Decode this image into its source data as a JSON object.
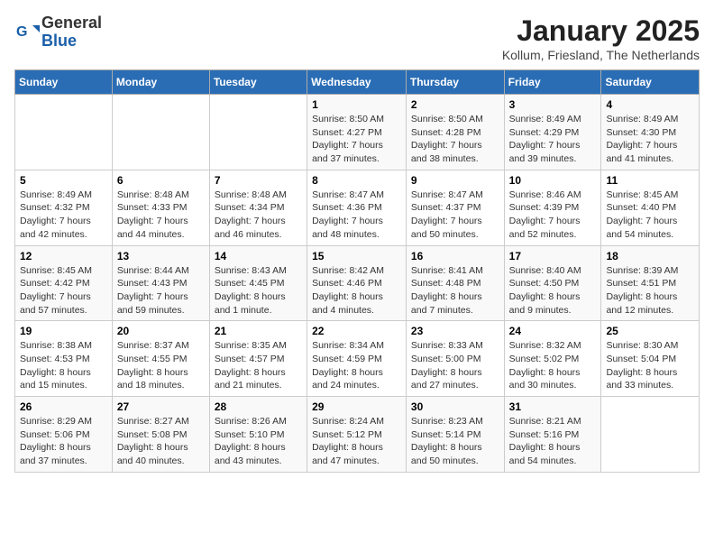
{
  "logo": {
    "general": "General",
    "blue": "Blue"
  },
  "title": "January 2025",
  "subtitle": "Kollum, Friesland, The Netherlands",
  "weekdays": [
    "Sunday",
    "Monday",
    "Tuesday",
    "Wednesday",
    "Thursday",
    "Friday",
    "Saturday"
  ],
  "weeks": [
    [
      {
        "day": "",
        "info": ""
      },
      {
        "day": "",
        "info": ""
      },
      {
        "day": "",
        "info": ""
      },
      {
        "day": "1",
        "info": "Sunrise: 8:50 AM\nSunset: 4:27 PM\nDaylight: 7 hours and 37 minutes."
      },
      {
        "day": "2",
        "info": "Sunrise: 8:50 AM\nSunset: 4:28 PM\nDaylight: 7 hours and 38 minutes."
      },
      {
        "day": "3",
        "info": "Sunrise: 8:49 AM\nSunset: 4:29 PM\nDaylight: 7 hours and 39 minutes."
      },
      {
        "day": "4",
        "info": "Sunrise: 8:49 AM\nSunset: 4:30 PM\nDaylight: 7 hours and 41 minutes."
      }
    ],
    [
      {
        "day": "5",
        "info": "Sunrise: 8:49 AM\nSunset: 4:32 PM\nDaylight: 7 hours and 42 minutes."
      },
      {
        "day": "6",
        "info": "Sunrise: 8:48 AM\nSunset: 4:33 PM\nDaylight: 7 hours and 44 minutes."
      },
      {
        "day": "7",
        "info": "Sunrise: 8:48 AM\nSunset: 4:34 PM\nDaylight: 7 hours and 46 minutes."
      },
      {
        "day": "8",
        "info": "Sunrise: 8:47 AM\nSunset: 4:36 PM\nDaylight: 7 hours and 48 minutes."
      },
      {
        "day": "9",
        "info": "Sunrise: 8:47 AM\nSunset: 4:37 PM\nDaylight: 7 hours and 50 minutes."
      },
      {
        "day": "10",
        "info": "Sunrise: 8:46 AM\nSunset: 4:39 PM\nDaylight: 7 hours and 52 minutes."
      },
      {
        "day": "11",
        "info": "Sunrise: 8:45 AM\nSunset: 4:40 PM\nDaylight: 7 hours and 54 minutes."
      }
    ],
    [
      {
        "day": "12",
        "info": "Sunrise: 8:45 AM\nSunset: 4:42 PM\nDaylight: 7 hours and 57 minutes."
      },
      {
        "day": "13",
        "info": "Sunrise: 8:44 AM\nSunset: 4:43 PM\nDaylight: 7 hours and 59 minutes."
      },
      {
        "day": "14",
        "info": "Sunrise: 8:43 AM\nSunset: 4:45 PM\nDaylight: 8 hours and 1 minute."
      },
      {
        "day": "15",
        "info": "Sunrise: 8:42 AM\nSunset: 4:46 PM\nDaylight: 8 hours and 4 minutes."
      },
      {
        "day": "16",
        "info": "Sunrise: 8:41 AM\nSunset: 4:48 PM\nDaylight: 8 hours and 7 minutes."
      },
      {
        "day": "17",
        "info": "Sunrise: 8:40 AM\nSunset: 4:50 PM\nDaylight: 8 hours and 9 minutes."
      },
      {
        "day": "18",
        "info": "Sunrise: 8:39 AM\nSunset: 4:51 PM\nDaylight: 8 hours and 12 minutes."
      }
    ],
    [
      {
        "day": "19",
        "info": "Sunrise: 8:38 AM\nSunset: 4:53 PM\nDaylight: 8 hours and 15 minutes."
      },
      {
        "day": "20",
        "info": "Sunrise: 8:37 AM\nSunset: 4:55 PM\nDaylight: 8 hours and 18 minutes."
      },
      {
        "day": "21",
        "info": "Sunrise: 8:35 AM\nSunset: 4:57 PM\nDaylight: 8 hours and 21 minutes."
      },
      {
        "day": "22",
        "info": "Sunrise: 8:34 AM\nSunset: 4:59 PM\nDaylight: 8 hours and 24 minutes."
      },
      {
        "day": "23",
        "info": "Sunrise: 8:33 AM\nSunset: 5:00 PM\nDaylight: 8 hours and 27 minutes."
      },
      {
        "day": "24",
        "info": "Sunrise: 8:32 AM\nSunset: 5:02 PM\nDaylight: 8 hours and 30 minutes."
      },
      {
        "day": "25",
        "info": "Sunrise: 8:30 AM\nSunset: 5:04 PM\nDaylight: 8 hours and 33 minutes."
      }
    ],
    [
      {
        "day": "26",
        "info": "Sunrise: 8:29 AM\nSunset: 5:06 PM\nDaylight: 8 hours and 37 minutes."
      },
      {
        "day": "27",
        "info": "Sunrise: 8:27 AM\nSunset: 5:08 PM\nDaylight: 8 hours and 40 minutes."
      },
      {
        "day": "28",
        "info": "Sunrise: 8:26 AM\nSunset: 5:10 PM\nDaylight: 8 hours and 43 minutes."
      },
      {
        "day": "29",
        "info": "Sunrise: 8:24 AM\nSunset: 5:12 PM\nDaylight: 8 hours and 47 minutes."
      },
      {
        "day": "30",
        "info": "Sunrise: 8:23 AM\nSunset: 5:14 PM\nDaylight: 8 hours and 50 minutes."
      },
      {
        "day": "31",
        "info": "Sunrise: 8:21 AM\nSunset: 5:16 PM\nDaylight: 8 hours and 54 minutes."
      },
      {
        "day": "",
        "info": ""
      }
    ]
  ]
}
